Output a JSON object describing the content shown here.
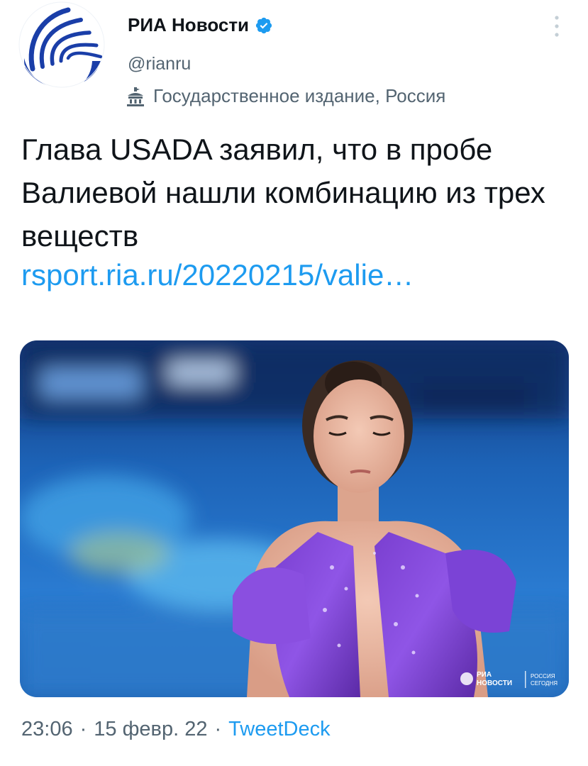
{
  "account": {
    "display_name": "РИА Новости",
    "handle": "@rianru",
    "label": "Государственное издание, Россия",
    "avatar_icon": "ria-logo-icon",
    "verified_icon": "verified-badge-icon",
    "label_icon": "government-building-icon"
  },
  "tweet": {
    "text": "Глава USADA заявил, что в пробе Валиевой нашли комбинацию из трех веществ",
    "link": "rsport.ria.ru/20220215/valie…",
    "media": {
      "watermark_left_top": "РИА",
      "watermark_left_bottom": "НОВОСТИ",
      "watermark_right_top": "РОССИЯ",
      "watermark_right_bottom": "СЕГОДНЯ"
    }
  },
  "footer": {
    "time": "23:06",
    "date": "15 февр. 22",
    "separator": "·",
    "source": "TweetDeck"
  },
  "colors": {
    "accent": "#1d9bf0",
    "secondary_text": "#536471",
    "logo_blue": "#1a3ea8"
  }
}
